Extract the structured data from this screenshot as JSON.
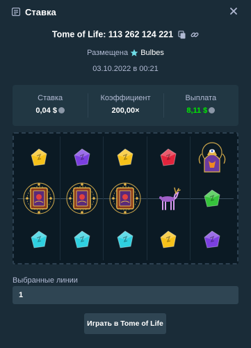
{
  "header": {
    "title": "Ставка"
  },
  "bet": {
    "game_title": "Tome of Life: 113 262 124 221",
    "placed_prefix": "Размещена",
    "user": "Bulbes",
    "date": "03.10.2022 в 00:21"
  },
  "stats": [
    {
      "label": "Ставка",
      "value": "0,04 $",
      "has_coin": true,
      "color": "#ffffff"
    },
    {
      "label": "Коэффициент",
      "value": "200,00×",
      "has_coin": false,
      "color": "#ffffff"
    },
    {
      "label": "Выплата",
      "value": "8,11 $",
      "has_coin": true,
      "color": "#00e701"
    }
  ],
  "reels": {
    "rows": [
      [
        "yellow-gem",
        "purple-gem",
        "yellow-gem",
        "red-gem",
        "wizard-scatter"
      ],
      [
        "book-of-life",
        "book-of-life",
        "book-of-life",
        "deer-symbol",
        "green-gem"
      ],
      [
        "cyan-gem",
        "cyan-gem",
        "cyan-gem",
        "yellow-gem",
        "purple-gem"
      ]
    ]
  },
  "lines": {
    "label": "Выбранные линии",
    "value": "1"
  },
  "play_button": {
    "label": "Играть в Tome of Life"
  },
  "colors": {
    "background": "#1a2c38",
    "panel": "#213743",
    "input": "#2f4553",
    "muted_text": "#b1bad3",
    "win_green": "#00e701",
    "yellow_gem": "#f7c21a",
    "purple_gem": "#7b3fe0",
    "red_gem": "#e3243c",
    "green_gem": "#36c43c",
    "cyan_gem": "#2fd0e0"
  }
}
